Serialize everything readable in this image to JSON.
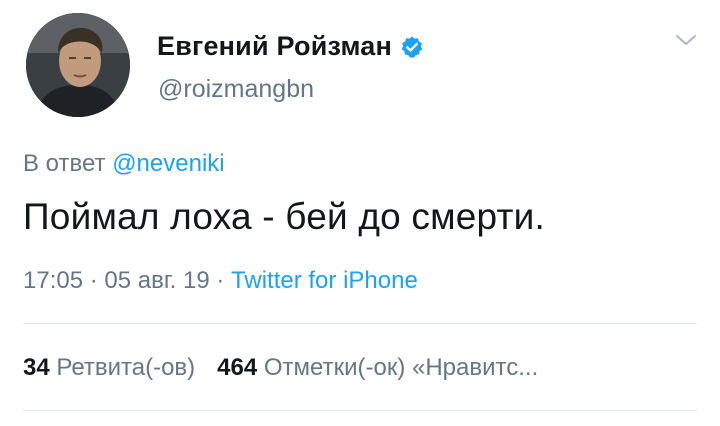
{
  "author": {
    "display_name": "Евгений Ройзман",
    "handle": "@roizmangbn",
    "verified_icon": "verified-badge-icon"
  },
  "reply": {
    "prefix": "В ответ",
    "mention": "@neveniki"
  },
  "tweet": {
    "text": "Поймал лоха - бей до смерти."
  },
  "meta": {
    "time": "17:05",
    "separator1": " · ",
    "date": "05 авг. 19",
    "separator2": " · ",
    "source": "Twitter for iPhone"
  },
  "stats": {
    "retweets_count": "34",
    "retweets_label": "Ретвита(-ов)",
    "likes_count": "464",
    "likes_label": "Отметки(-ок) «Нравитс..."
  },
  "colors": {
    "link": "#1da1f2",
    "secondary_text": "#657786",
    "primary_text": "#14171a",
    "divider": "#e1e8ed"
  }
}
